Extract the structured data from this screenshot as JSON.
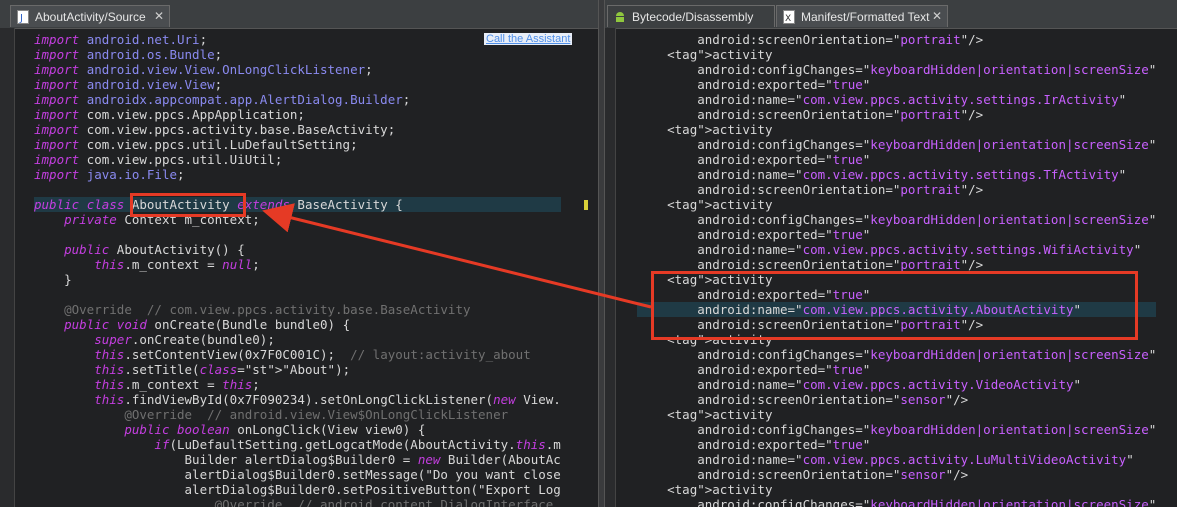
{
  "left_tab": {
    "label": "AboutActivity/Source",
    "icon": "java-file-icon",
    "close": "✕"
  },
  "right_tabs": [
    {
      "label": "Bytecode/Disassembly",
      "icon": "android-icon"
    },
    {
      "label": "Manifest/Formatted Text",
      "icon": "xml-file-icon",
      "close": "✕"
    }
  ],
  "assistant_link": "Call the Assistant",
  "source_lines": [
    "import android.net.Uri;",
    "import android.os.Bundle;",
    "import android.view.View.OnLongClickListener;",
    "import android.view.View;",
    "import androidx.appcompat.app.AlertDialog.Builder;",
    "import com.view.ppcs.AppApplication;",
    "import com.view.ppcs.activity.base.BaseActivity;",
    "import com.view.ppcs.util.LuDefaultSetting;",
    "import com.view.ppcs.util.UiUtil;",
    "import java.io.File;",
    "",
    "public class AboutActivity extends BaseActivity {",
    "    private Context m_context;",
    "",
    "    public AboutActivity() {",
    "        this.m_context = null;",
    "    }",
    "",
    "    @Override  // com.view.ppcs.activity.base.BaseActivity",
    "    public void onCreate(Bundle bundle0) {",
    "        super.onCreate(bundle0);",
    "        this.setContentView(0x7F0C001C);  // layout:activity_about",
    "        this.setTitle(\"About\");",
    "        this.m_context = this;",
    "        this.findViewById(0x7F090234).setOnLongClickListener(new View.",
    "            @Override  // android.view.View$OnLongClickListener",
    "            public boolean onLongClick(View view0) {",
    "                if(LuDefaultSetting.getLogcatMode(AboutActivity.this.m",
    "                    Builder alertDialog$Builder0 = new Builder(AboutAc",
    "                    alertDialog$Builder0.setMessage(\"Do you want close",
    "                    alertDialog$Builder0.setPositiveButton(\"Export Log",
    "                        @Override  // android.content.DialogInterface"
  ],
  "manifest_lines": [
    "        android:screenOrientation=\"portrait\"/>",
    "    <activity",
    "        android:configChanges=\"keyboardHidden|orientation|screenSize\"",
    "        android:exported=\"true\"",
    "        android:name=\"com.view.ppcs.activity.settings.IrActivity\"",
    "        android:screenOrientation=\"portrait\"/>",
    "    <activity",
    "        android:configChanges=\"keyboardHidden|orientation|screenSize\"",
    "        android:exported=\"true\"",
    "        android:name=\"com.view.ppcs.activity.settings.TfActivity\"",
    "        android:screenOrientation=\"portrait\"/>",
    "    <activity",
    "        android:configChanges=\"keyboardHidden|orientation|screenSize\"",
    "        android:exported=\"true\"",
    "        android:name=\"com.view.ppcs.activity.settings.WifiActivity\"",
    "        android:screenOrientation=\"portrait\"/>",
    "    <activity",
    "        android:exported=\"true\"",
    "        android:name=\"com.view.ppcs.activity.AboutActivity\"",
    "        android:screenOrientation=\"portrait\"/>",
    "    <activity",
    "        android:configChanges=\"keyboardHidden|orientation|screenSize\"",
    "        android:exported=\"true\"",
    "        android:name=\"com.view.ppcs.activity.VideoActivity\"",
    "        android:screenOrientation=\"sensor\"/>",
    "    <activity",
    "        android:configChanges=\"keyboardHidden|orientation|screenSize\"",
    "        android:exported=\"true\"",
    "        android:name=\"com.view.ppcs.activity.LuMultiVideoActivity\"",
    "        android:screenOrientation=\"sensor\"/>",
    "    <activity",
    "        android:configChanges=\"keyboardHidden|orientation|screenSize\""
  ],
  "colors": {
    "annotation_red": "#e53a25",
    "highlight_line": "#1f3a45"
  }
}
